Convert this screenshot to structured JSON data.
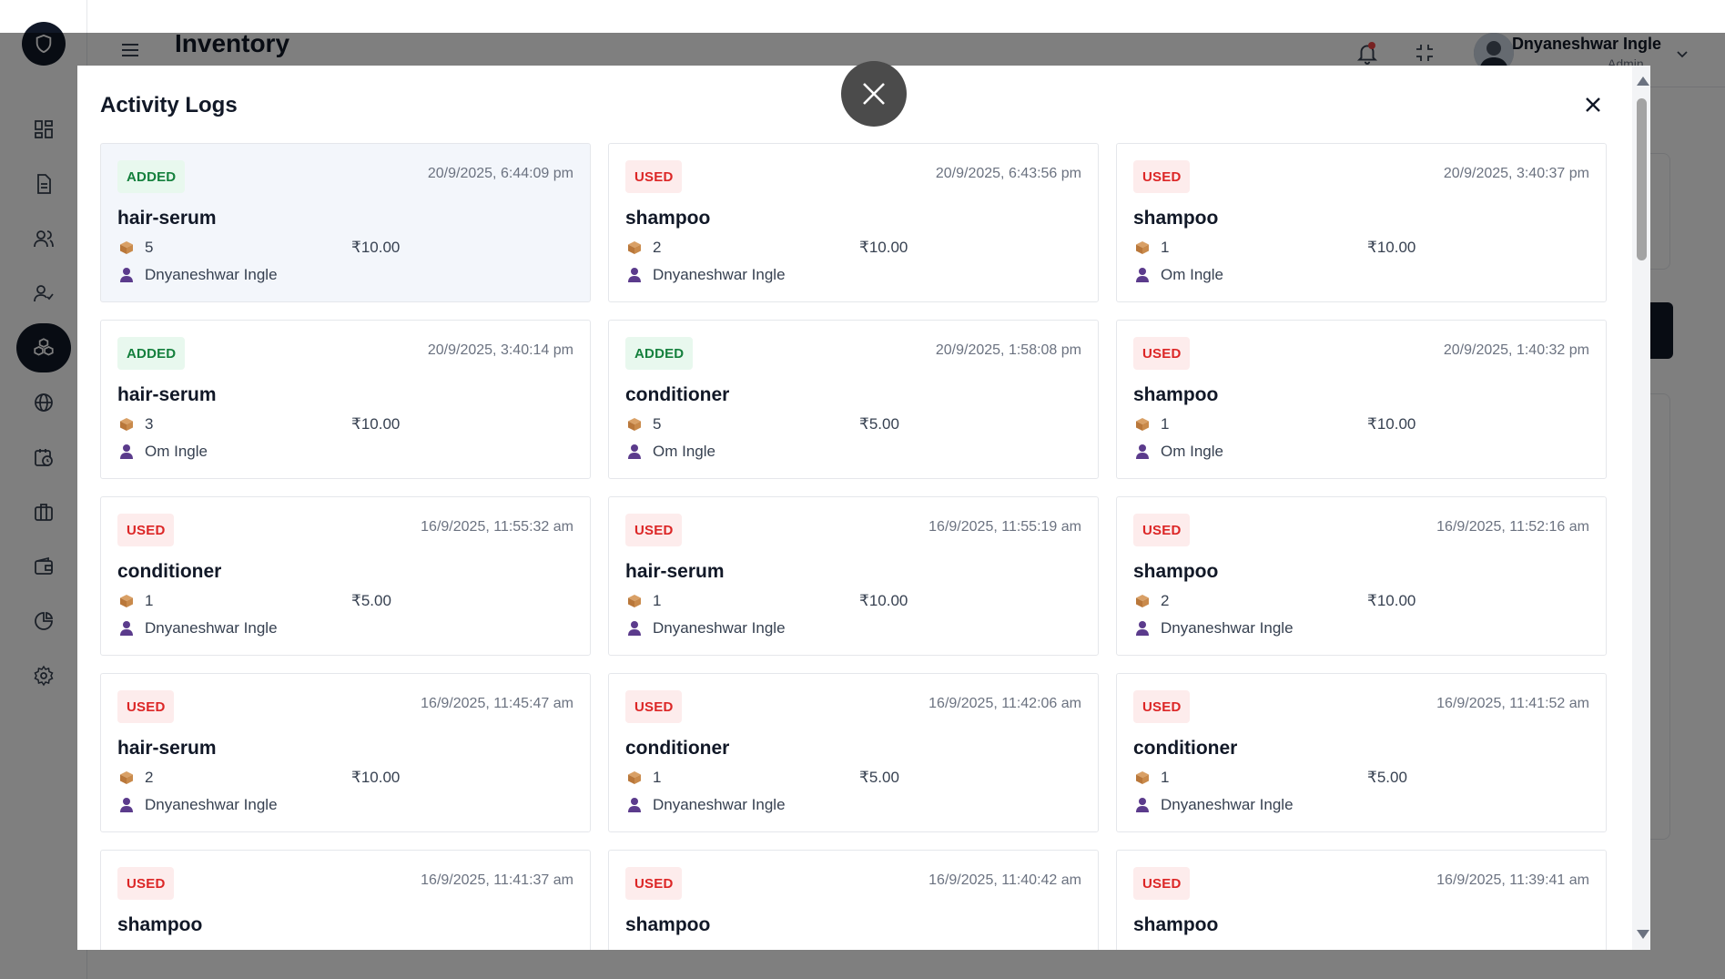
{
  "app": {
    "page_title": "Inventory",
    "user_name": "Dnyaneshwar Ingle",
    "user_role": "Admin"
  },
  "modal": {
    "title": "Activity Logs",
    "logs": [
      {
        "action": "ADDED",
        "time": "20/9/2025, 6:44:09 pm",
        "item": "hair-serum",
        "qty": "5",
        "price": "₹10.00",
        "user": "Dnyaneshwar Ingle",
        "highlight": true
      },
      {
        "action": "USED",
        "time": "20/9/2025, 6:43:56 pm",
        "item": "shampoo",
        "qty": "2",
        "price": "₹10.00",
        "user": "Dnyaneshwar Ingle"
      },
      {
        "action": "USED",
        "time": "20/9/2025, 3:40:37 pm",
        "item": "shampoo",
        "qty": "1",
        "price": "₹10.00",
        "user": "Om Ingle"
      },
      {
        "action": "ADDED",
        "time": "20/9/2025, 3:40:14 pm",
        "item": "hair-serum",
        "qty": "3",
        "price": "₹10.00",
        "user": "Om Ingle"
      },
      {
        "action": "ADDED",
        "time": "20/9/2025, 1:58:08 pm",
        "item": "conditioner",
        "qty": "5",
        "price": "₹5.00",
        "user": "Om Ingle"
      },
      {
        "action": "USED",
        "time": "20/9/2025, 1:40:32 pm",
        "item": "shampoo",
        "qty": "1",
        "price": "₹10.00",
        "user": "Om Ingle"
      },
      {
        "action": "USED",
        "time": "16/9/2025, 11:55:32 am",
        "item": "conditioner",
        "qty": "1",
        "price": "₹5.00",
        "user": "Dnyaneshwar Ingle"
      },
      {
        "action": "USED",
        "time": "16/9/2025, 11:55:19 am",
        "item": "hair-serum",
        "qty": "1",
        "price": "₹10.00",
        "user": "Dnyaneshwar Ingle"
      },
      {
        "action": "USED",
        "time": "16/9/2025, 11:52:16 am",
        "item": "shampoo",
        "qty": "2",
        "price": "₹10.00",
        "user": "Dnyaneshwar Ingle"
      },
      {
        "action": "USED",
        "time": "16/9/2025, 11:45:47 am",
        "item": "hair-serum",
        "qty": "2",
        "price": "₹10.00",
        "user": "Dnyaneshwar Ingle"
      },
      {
        "action": "USED",
        "time": "16/9/2025, 11:42:06 am",
        "item": "conditioner",
        "qty": "1",
        "price": "₹5.00",
        "user": "Dnyaneshwar Ingle"
      },
      {
        "action": "USED",
        "time": "16/9/2025, 11:41:52 am",
        "item": "conditioner",
        "qty": "1",
        "price": "₹5.00",
        "user": "Dnyaneshwar Ingle"
      },
      {
        "action": "USED",
        "time": "16/9/2025, 11:41:37 am",
        "item": "shampoo",
        "qty": "",
        "price": "",
        "user": ""
      },
      {
        "action": "USED",
        "time": "16/9/2025, 11:40:42 am",
        "item": "shampoo",
        "qty": "",
        "price": "",
        "user": ""
      },
      {
        "action": "USED",
        "time": "16/9/2025, 11:39:41 am",
        "item": "shampoo",
        "qty": "",
        "price": "",
        "user": ""
      }
    ]
  },
  "colors": {
    "added_text": "#15803d",
    "added_bg": "#e8f8ee",
    "used_text": "#dc2626",
    "used_bg": "#fdecec",
    "sidebar_active": "#111827"
  }
}
